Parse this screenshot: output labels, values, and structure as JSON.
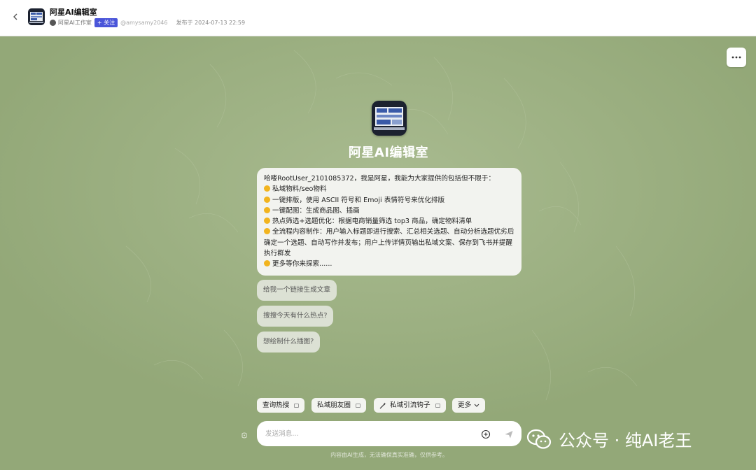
{
  "header": {
    "title": "阿星AI编辑室",
    "author": "阿星AI工作室",
    "follow_label": "+ 关注",
    "handle": "@amysamy2046",
    "published": "发布于 2024-07-13 22:59"
  },
  "bot": {
    "name": "阿星AI编辑室"
  },
  "intro": {
    "greeting": "哈喽RootUser_2101085372，我是阿星，我能为大家提供的包括但不限于：",
    "items": [
      "私域物料/seo物料",
      "一键排版，使用 ASCII 符号和 Emoji 表情符号来优化排版",
      "一键配图：生成商品图、插画",
      "热点筛选+选题优化：根据电商销量筛选 top3 商品，确定物料清单",
      "全流程内容制作：用户输入标题即进行搜索、汇总相关选题、自动分析选题优劣后确定一个选题、自动写作并发布；用户上传详情页输出私域文案、保存到飞书并提醒执行群发",
      "更多等你来探索......"
    ]
  },
  "suggestions": [
    "给我一个链接生成文章",
    "搜搜今天有什么热点?",
    "想绘制什么插图?"
  ],
  "shortcuts": [
    "查询热搜",
    "私域朋友圈",
    "私域引流钩子"
  ],
  "more_label": "更多",
  "input": {
    "placeholder": "发送消息..."
  },
  "disclaimer": "内容由AI生成，无法确保真实准确，仅供参考。",
  "watermark": "公众号 · 纯AI老王",
  "colors": {
    "background": "#97ac7c",
    "accent": "#4a55d9"
  }
}
